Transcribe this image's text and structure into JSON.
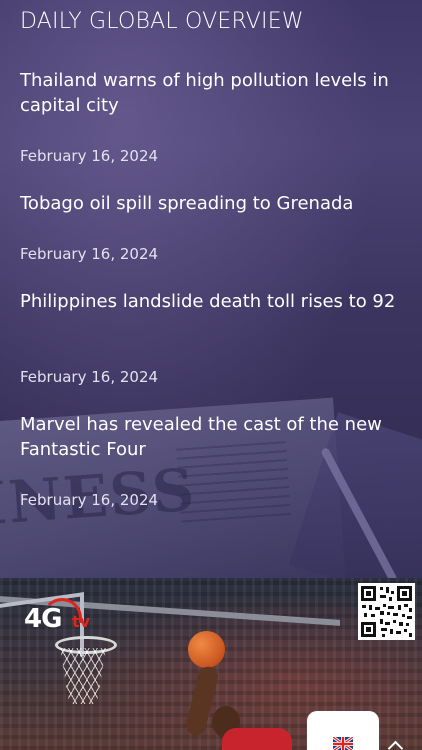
{
  "header": {
    "title": "DAILY GLOBAL OVERVIEW"
  },
  "news": [
    {
      "headline": "Thailand warns of high pollution levels in capital city",
      "date": "February 16, 2024"
    },
    {
      "headline": "Tobago oil spill spreading to Grenada",
      "date": "February 16, 2024"
    },
    {
      "headline": "Philippines landslide death toll rises to 92",
      "date": "February 16, 2024"
    },
    {
      "headline": "Marvel has revealed the cast of the new Fantastic Four",
      "date": "February 16, 2024"
    }
  ],
  "video": {
    "channel_logo_icon": "4g-tv-logo-icon",
    "qr_icon": "qr-code-icon",
    "language_flag_icon": "uk-flag-icon",
    "expand_icon": "chevron-up-icon"
  },
  "colors": {
    "overlay": "#3f3767",
    "accent_red": "#e0231b",
    "text": "#ffffff"
  }
}
